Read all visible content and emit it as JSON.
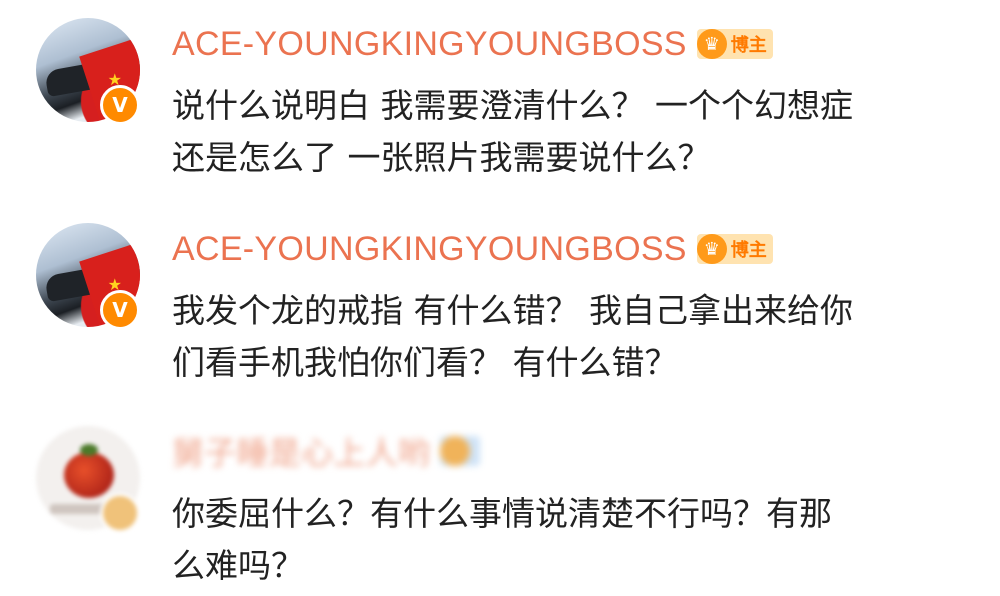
{
  "comments": [
    {
      "username": "ACE-YOUNGKINGYOUNGBOSS",
      "badge_label": "博主",
      "verified_label": "V",
      "lines": [
        "说什么说明白 我需要澄清什么？ 一个个幻想症",
        "还是怎么了 一张照片我需要说什么？"
      ]
    },
    {
      "username": "ACE-YOUNGKINGYOUNGBOSS",
      "badge_label": "博主",
      "verified_label": "V",
      "lines": [
        "我发个龙的戒指 有什么错？ 我自己拿出来给你",
        "们看手机我怕你们看？ 有什么错？"
      ]
    },
    {
      "username": "舅子睡是心上人哟",
      "badge_label": "",
      "verified_label": "",
      "lines": [
        "你委屈什么？有什么事情说清楚不行吗？有那",
        "么难吗？"
      ]
    }
  ],
  "colors": {
    "username": "#eb7350",
    "text": "#222222",
    "verified_badge": "#ff8a00",
    "crown_badge_bg": "#ffe3b0"
  },
  "icons": [
    "verified-v-icon",
    "crown-icon"
  ]
}
